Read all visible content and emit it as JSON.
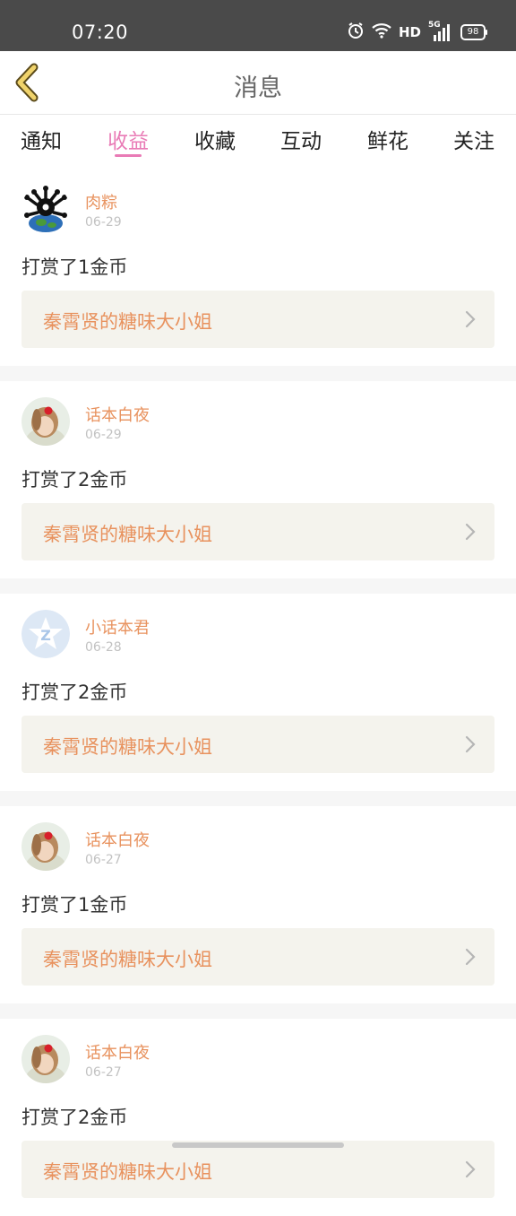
{
  "status_bar": {
    "time": "07:20",
    "network": "HD",
    "signal": "5G",
    "battery": "98"
  },
  "header": {
    "title": "消息"
  },
  "tabs": [
    {
      "label": "通知"
    },
    {
      "label": "收益"
    },
    {
      "label": "收藏"
    },
    {
      "label": "互动"
    },
    {
      "label": "鲜花"
    },
    {
      "label": "关注"
    }
  ],
  "active_tab": "收益",
  "items": [
    {
      "user": "肉粽",
      "date": "06-29",
      "action": "打赏了1金币",
      "book": "秦霄贤的糖味大小姐"
    },
    {
      "user": "话本白夜",
      "date": "06-29",
      "action": "打赏了2金币",
      "book": "秦霄贤的糖味大小姐"
    },
    {
      "user": "小话本君",
      "date": "06-28",
      "action": "打赏了2金币",
      "book": "秦霄贤的糖味大小姐"
    },
    {
      "user": "话本白夜",
      "date": "06-27",
      "action": "打赏了1金币",
      "book": "秦霄贤的糖味大小姐"
    },
    {
      "user": "话本白夜",
      "date": "06-27",
      "action": "打赏了2金币",
      "book": "秦霄贤的糖味大小姐"
    }
  ],
  "colors": {
    "accent_pink": "#e97bb6",
    "name_orange": "#e8925e",
    "status_bar": "#4a4a4a",
    "card_link_bg": "#f4f3ed"
  },
  "icons": [
    "back-arrow-icon",
    "alarm-icon",
    "wifi-icon",
    "signal-icon",
    "battery-icon",
    "chevron-right-icon"
  ]
}
